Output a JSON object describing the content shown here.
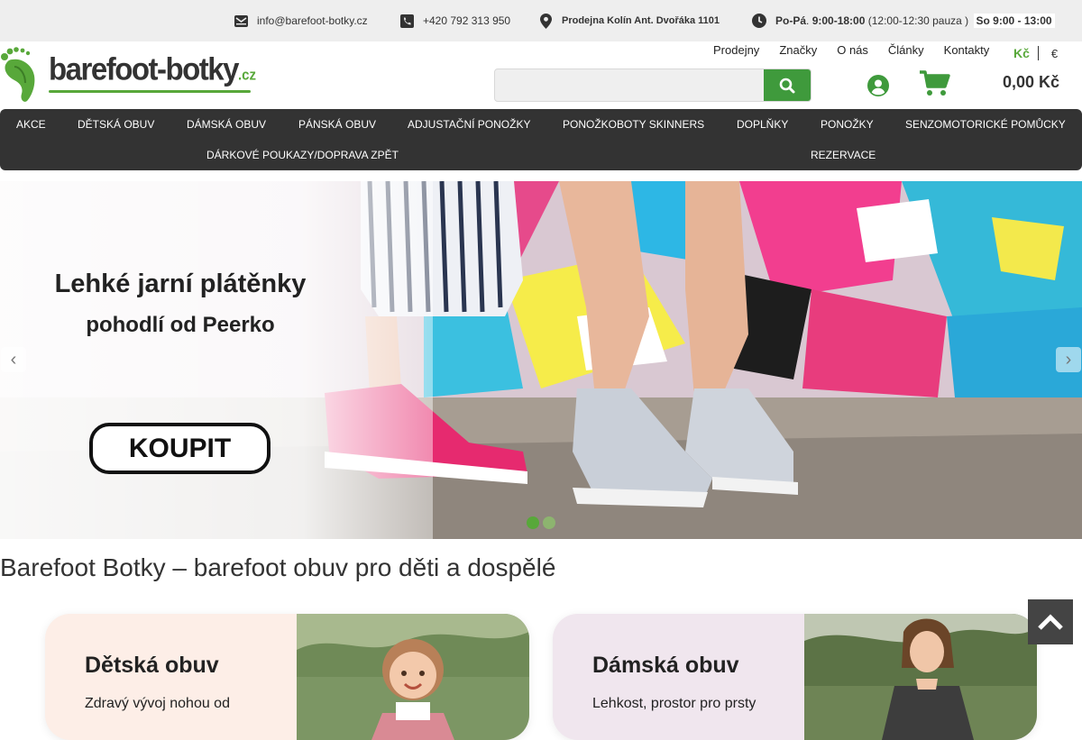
{
  "topbar": {
    "email": "info@barefoot-botky.cz",
    "phone": "+420 792 313 950",
    "store": "Prodejna Kolín Ant. Dvořáka 1101",
    "hours_days": "Po-Pá",
    "hours_time": "9:00-18:00",
    "hours_pause": "(12:00-12:30 pauza )",
    "hours_weekend": "So 9:00 - 13:00"
  },
  "logo": {
    "main": "barefoot-botky",
    "tld": ".cz"
  },
  "topnav": [
    "Prodejny",
    "Značky",
    "O nás",
    "Články",
    "Kontakty"
  ],
  "currency": {
    "active": "Kč",
    "other": "€"
  },
  "search": {
    "placeholder": "",
    "value": ""
  },
  "cart": {
    "total": "0,00 Kč"
  },
  "mainnav": {
    "row1": [
      "AKCE",
      "DĚTSKÁ OBUV",
      "DÁMSKÁ OBUV",
      "PÁNSKÁ OBUV",
      "ADJUSTAČNÍ PONOŽKY",
      "PONOŽKOBOTY SKINNERS",
      "DOPLŇKY",
      "PONOŽKY",
      "SENZOMOTORICKÉ POMŮCKY"
    ],
    "row2": [
      "DÁRKOVÉ POUKAZY/DOPRAVA ZPĚT",
      "REZERVACE"
    ]
  },
  "hero": {
    "title": "Lehké jarní plátěnky",
    "subtitle": "pohodlí od Peerko",
    "button": "KOUPIT",
    "prev": "‹",
    "next": "›"
  },
  "heading": "Barefoot Botky – barefoot obuv pro děti a dospělé",
  "cards": {
    "kids": {
      "title": "Dětská obuv",
      "text": "Zdravý vývoj nohou od"
    },
    "women": {
      "title": "Dámská obuv",
      "text": "Lehkost, prostor pro prsty"
    }
  },
  "colors": {
    "brand_green": "#58a83a",
    "search_button": "#3f9a3c",
    "nav_background": "#333333",
    "topbar_background": "#eeeeee"
  },
  "icons": [
    "envelope-icon",
    "phone-icon",
    "map-pin-icon",
    "clock-icon",
    "search-icon",
    "user-icon",
    "cart-icon",
    "chevron-left-icon",
    "chevron-right-icon",
    "arrow-up-icon",
    "footprint-logo-icon"
  ]
}
